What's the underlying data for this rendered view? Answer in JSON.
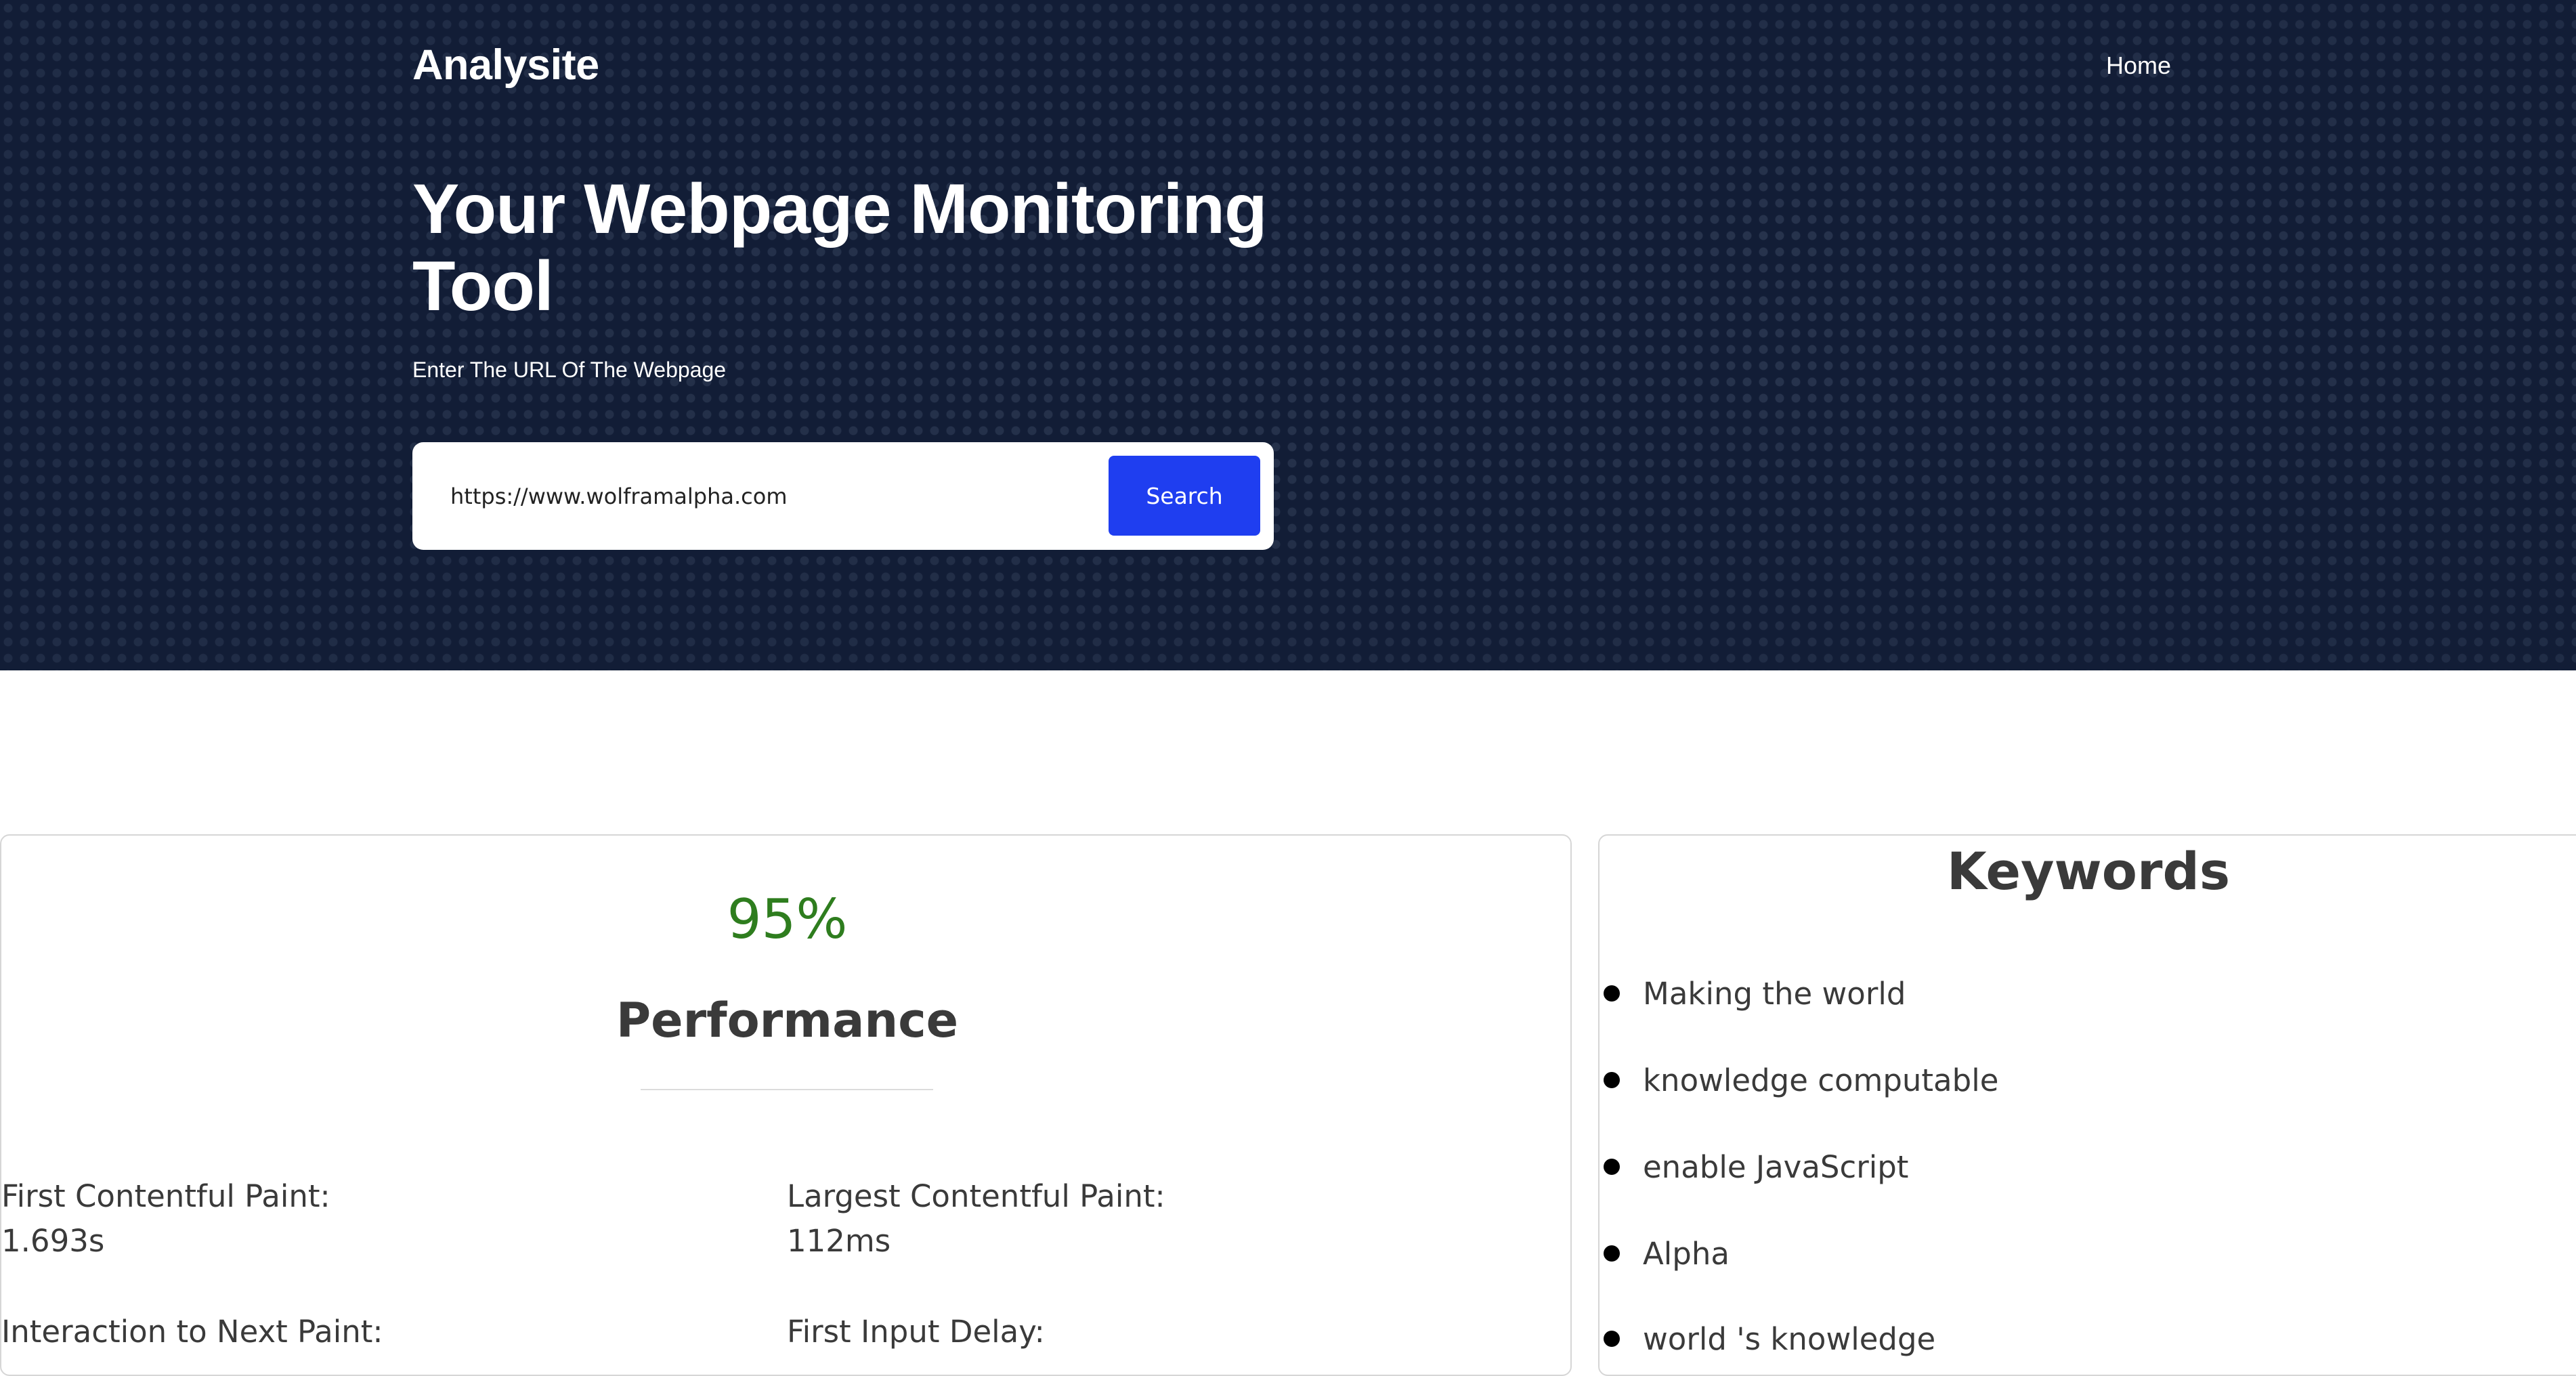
{
  "header": {
    "brand": "Analysite",
    "nav": {
      "home": "Home"
    }
  },
  "hero": {
    "title": "Your Webpage Monitoring Tool",
    "subtitle": "Enter The URL Of The Webpage",
    "search": {
      "value": "https://www.wolframalpha.com",
      "button_label": "Search"
    }
  },
  "performance": {
    "score": "95%",
    "score_color": "#2e7d1e",
    "title": "Performance",
    "metrics": [
      {
        "label": "First Contentful Paint:",
        "value": "1.693s"
      },
      {
        "label": "Largest Contentful Paint:",
        "value": "112ms"
      },
      {
        "label": "Interaction to Next Paint:",
        "value": ""
      },
      {
        "label": "First Input Delay:",
        "value": ""
      }
    ]
  },
  "keywords": {
    "title": "Keywords",
    "items": [
      "Making the world",
      "knowledge computable",
      "enable JavaScript",
      "Alpha",
      "world 's knowledge"
    ]
  },
  "colors": {
    "hero_bg": "#121d36",
    "accent": "#1f3ef0"
  }
}
